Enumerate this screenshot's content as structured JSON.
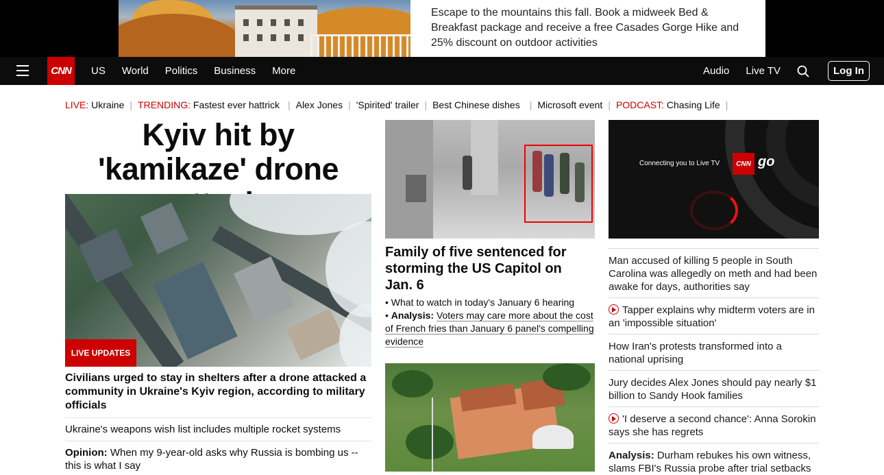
{
  "ad": {
    "text": "Escape to the mountains this fall. Book a midweek Bed & Breakfast package and receive a free Casades Gorge Hike and 25% discount on outdoor activities"
  },
  "nav": {
    "logo": "CNN",
    "links": [
      "US",
      "World",
      "Politics",
      "Business",
      "More"
    ],
    "audio": "Audio",
    "live_tv": "Live TV",
    "login": "Log In"
  },
  "trending": {
    "live_label": "LIVE:",
    "live_text": "Ukraine",
    "trending_label": "TRENDING:",
    "trending_text": "Fastest ever hattrick",
    "items": [
      "Alex Jones",
      "'Spirited' trailer",
      "Best Chinese dishes",
      "Microsoft event"
    ],
    "podcast_label": "PODCAST:",
    "podcast_text": "Chasing Life"
  },
  "left": {
    "headline": "Kyiv hit by 'kamikaze' drone attack",
    "badge": "LIVE UPDATES",
    "lead": "Civilians urged to stay in shelters after a drone attacked a community in Ukraine's Kyiv region, according to military officials",
    "story1": "Ukraine's weapons wish list includes multiple rocket systems",
    "story2_label": "Opinion:",
    "story2_text": "When my 9-year-old asks why Russia is bombing us -- this is what I say"
  },
  "middle": {
    "headline": "Family of five sentenced for storming the US Capitol on Jan. 6",
    "bullet1": "What to watch in today's January 6 hearing",
    "bullet2_label": "Analysis:",
    "bullet2_text": "Voters may care more about the cost of French fries than January 6 panel's compelling evidence"
  },
  "right": {
    "video_connecting": "Connecting you to Live TV",
    "video_logo": "CNN",
    "video_go": "go",
    "stories": [
      "Man accused of killing 5 people in South Carolina was allegedly on meth and had been awake for days, authorities say",
      "Tapper explains why midterm voters are in an 'impossible situation'",
      "How Iran's protests transformed into a national uprising",
      "Jury decides Alex Jones should pay nearly $1 billion to Sandy Hook families",
      "'I deserve a second chance': Anna Sorokin says she has regrets"
    ],
    "last_label": "Analysis:",
    "last_text": "Durham rebukes his own witness, slams FBI's Russia probe after trial setbacks"
  },
  "colors": {
    "brand": "#cc0000",
    "nav_bg": "#0c0c0c"
  }
}
